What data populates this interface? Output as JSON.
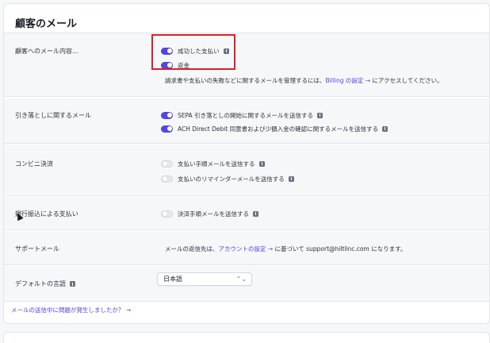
{
  "panel": {
    "title": "顧客のメール"
  },
  "rows": {
    "customer_email": {
      "label": "顧客へのメール内容...",
      "options": [
        {
          "label": "成功した支払い",
          "on": true
        },
        {
          "label": "返金",
          "on": true
        }
      ],
      "note_prefix": "請求書や支払いの失敗などに関するメールを管理するには、",
      "note_link": "Billing の設定 →",
      "note_suffix": " にアクセスしてください。"
    },
    "direct_debit": {
      "label": "引き落としに関するメール",
      "options": [
        {
          "label": "SEPA 引き落としの開始に関するメールを送信する",
          "on": true
        },
        {
          "label": "ACH Direct Debit 同意書および少額入金の確認に関するメールを送信する",
          "on": true
        }
      ]
    },
    "konbini": {
      "label": "コンビニ決済",
      "options": [
        {
          "label": "支払い手順メールを送信する",
          "on": false
        },
        {
          "label": "支払いのリマインダーメールを送信する",
          "on": false
        }
      ]
    },
    "bank_transfer": {
      "label": "銀行振込による支払い",
      "options": [
        {
          "label": "決済手順メールを送信する",
          "on": false
        }
      ]
    },
    "support_email": {
      "label": "サポートメール",
      "note_prefix": "メールの返信先は、",
      "note_link": "アカウントの設定 →",
      "note_suffix": " に基づいて support@hiltlinc.com になります。"
    },
    "default_language": {
      "label": "デフォルトの言語",
      "selected": "日本語"
    }
  },
  "footer": {
    "link": "メールの送信中に問題が発生しましたか？ →"
  },
  "colors": {
    "accent": "#4f46e5",
    "highlight": "#e11d2a"
  }
}
